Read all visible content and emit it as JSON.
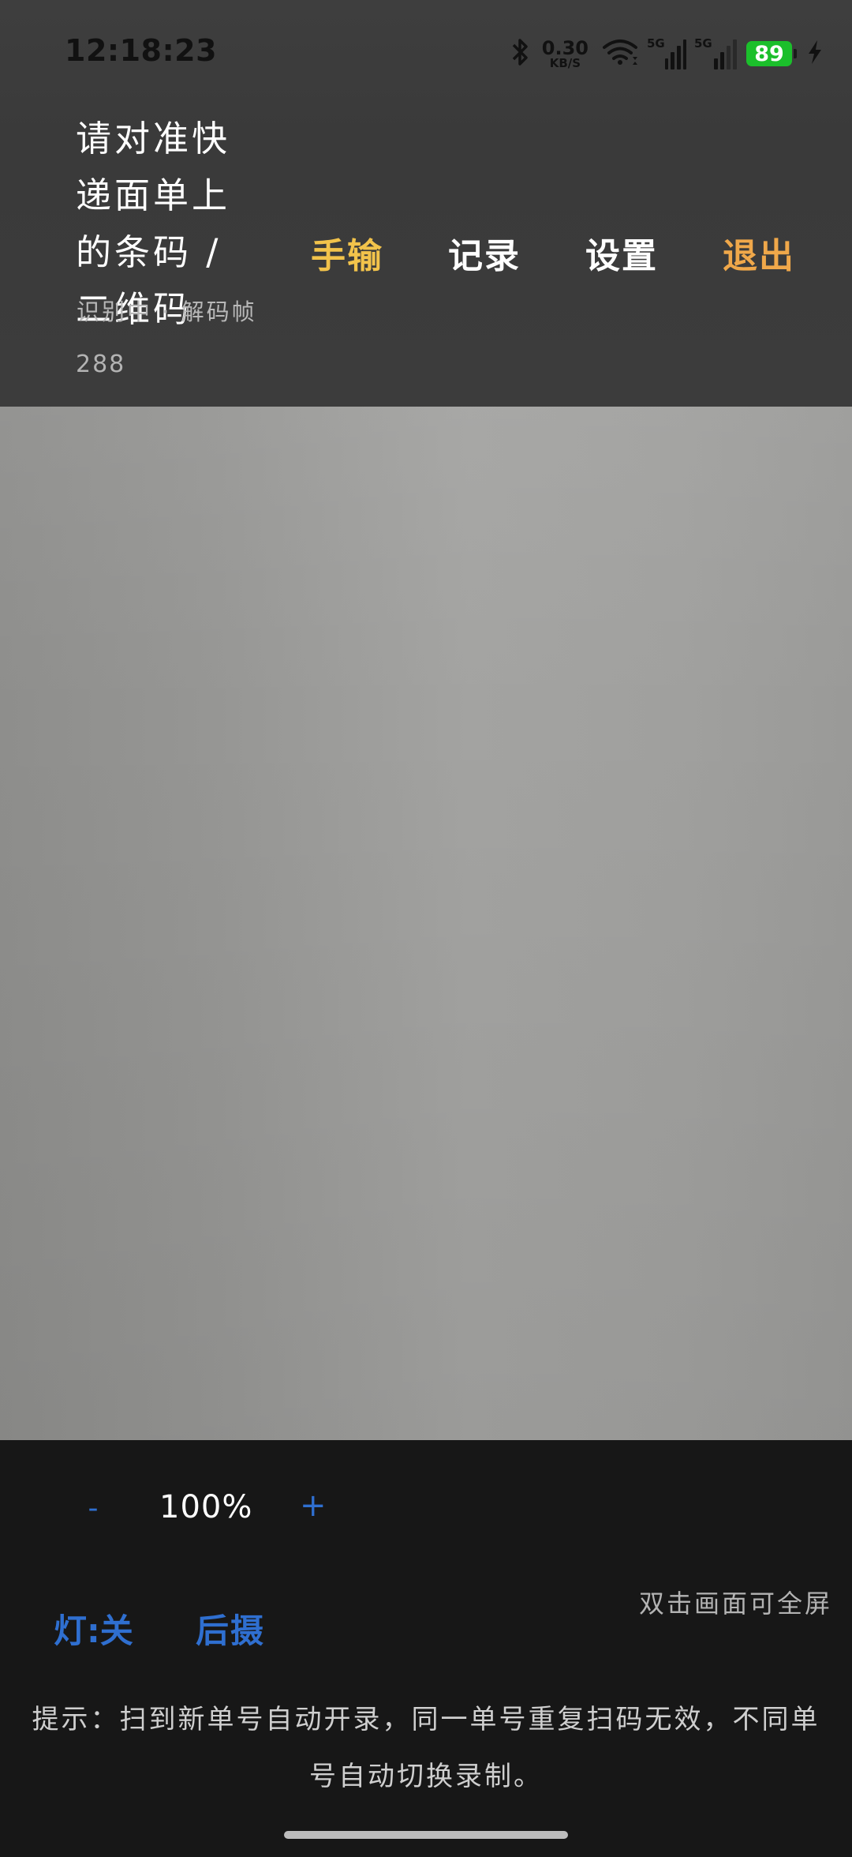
{
  "status_bar": {
    "time": "12:18:23",
    "net_speed_value": "0.30",
    "net_speed_unit": "KB/S",
    "signal1_label": "5G",
    "signal2_label": "5G",
    "battery_level": "89",
    "icons": [
      "bluetooth-icon",
      "wifi-icon",
      "signal-icon",
      "signal-icon",
      "battery-icon",
      "charging-icon"
    ],
    "battery_color": "#1bbf2b"
  },
  "header": {
    "prompt": "请对准快递面单上的条码 / 二维码",
    "actions": {
      "manual": "手输",
      "records": "记录",
      "settings": "设置",
      "exit": "退出"
    },
    "status_text": "识别中 · 解码帧",
    "frame_count": "288"
  },
  "colors": {
    "manual": "#f2c34b",
    "exit": "#f0a84a",
    "accent_blue": "#2f6fd0"
  },
  "controls": {
    "zoom_minus": "-",
    "zoom_value": "100%",
    "zoom_plus": "+",
    "fullscreen_hint": "双击画面可全屏",
    "light_toggle": "灯:关",
    "camera_switch": "后摄"
  },
  "tip": "提示：扫到新单号自动开录，同一单号重复扫码无效，不同单号自动切换录制。"
}
